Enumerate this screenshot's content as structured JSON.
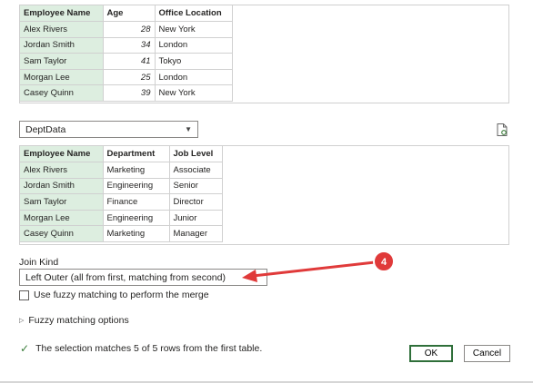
{
  "first_table": {
    "headers": [
      "Employee Name",
      "Age",
      "Office Location"
    ],
    "rows": [
      [
        "Alex Rivers",
        "28",
        "New York"
      ],
      [
        "Jordan Smith",
        "34",
        "London"
      ],
      [
        "Sam Taylor",
        "41",
        "Tokyo"
      ],
      [
        "Morgan Lee",
        "25",
        "London"
      ],
      [
        "Casey Quinn",
        "39",
        "New York"
      ]
    ]
  },
  "second_table_select": {
    "value": "DeptData",
    "chevron_icon": "chevron-down-icon"
  },
  "doc_icon": "document-refresh-icon",
  "second_table": {
    "headers": [
      "Employee Name",
      "Department",
      "Job Level"
    ],
    "rows": [
      [
        "Alex Rivers",
        "Marketing",
        "Associate"
      ],
      [
        "Jordan Smith",
        "Engineering",
        "Senior"
      ],
      [
        "Sam Taylor",
        "Finance",
        "Director"
      ],
      [
        "Morgan Lee",
        "Engineering",
        "Junior"
      ],
      [
        "Casey Quinn",
        "Marketing",
        "Manager"
      ]
    ]
  },
  "join_kind": {
    "label": "Join Kind",
    "value": "Left Outer (all from first, matching from second)"
  },
  "fuzzy": {
    "checkbox_label": "Use fuzzy matching to perform the merge",
    "checked": false
  },
  "fuzzy_options": {
    "label": "Fuzzy matching options"
  },
  "status": {
    "message": "The selection matches 5 of 5 rows from the first table."
  },
  "buttons": {
    "ok": "OK",
    "cancel": "Cancel"
  },
  "annotation": {
    "badge": "4",
    "color": "#e03a3a"
  },
  "colors": {
    "key_column": "#ddeee0",
    "ok_border": "#2f6f3a",
    "check": "#3a7d3a"
  }
}
